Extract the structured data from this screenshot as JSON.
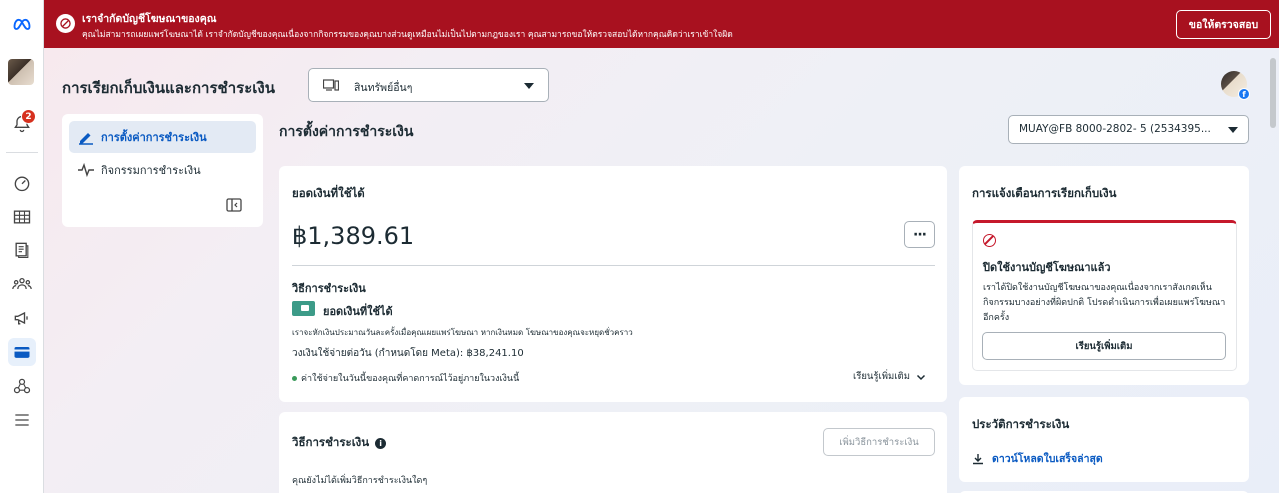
{
  "banner": {
    "title": "เราจำกัดบัญชีโฆษณาของคุณ",
    "subtitle": "คุณไม่สามารถเผยแพร่โฆษณาได้ เราจำกัดบัญชีของคุณเนื่องจากกิจกรรมของคุณบางส่วนดูเหมือนไม่เป็นไปตามกฎของเรา คุณสามารถขอให้ตรวจสอบได้หากคุณคิดว่าเราเข้าใจผิด",
    "review_button": "ขอให้ตรวจสอบ",
    "color": "#a8111f"
  },
  "rail": {
    "notification_count": "2",
    "icons": [
      "meta-logo",
      "profile-avatar",
      "bell-icon",
      "dashboard-icon",
      "table-icon",
      "pages-icon",
      "audience-icon",
      "megaphone-icon",
      "billing-card-icon",
      "business-settings-icon",
      "menu-icon"
    ]
  },
  "header": {
    "page_title": "การเรียกเก็บเงินและการชำระเงิน",
    "asset_select": "สินทรัพย์อื่นๆ"
  },
  "subnav": {
    "items": [
      {
        "label": "การตั้งค่าการชำระเงิน",
        "icon": "pencil-icon",
        "active": true
      },
      {
        "label": "กิจกรรมการชำระเงิน",
        "icon": "activity-icon",
        "active": false
      }
    ]
  },
  "section": {
    "title": "การตั้งค่าการชำระเงิน",
    "account_select": "MUAY@FB 8000-2802- 5 (2534395..."
  },
  "balance": {
    "title": "ยอดเงินที่ใช้ได้",
    "amount": "฿1,389.61",
    "more": "···",
    "method_title": "วิธีการชำระเงิน",
    "method_name": "ยอดเงินที่ใช้ได้",
    "method_desc": "เราจะหักเงินประมาณวันละครั้งเมื่อคุณเผยแพร่โฆษณา หากเงินหมด โฆษณาของคุณจะหยุดชั่วคราว",
    "daily_limit": "วงเงินใช้จ่ายต่อวัน (กำหนดโดย Meta): ฿38,241.10",
    "estimate": "ค่าใช้จ่ายในวันนี้ของคุณที่คาดการณ์ไว้อยู่ภายในวงเงินนี้",
    "learn_more": "เรียนรู้เพิ่มเติม"
  },
  "payment": {
    "title": "วิธีการชำระเงิน",
    "add_button": "เพิ่มวิธีการชำระเงิน",
    "none_text": "คุณยังไม่ได้เพิ่มวิธีการชำระเงินใดๆ"
  },
  "alerts": {
    "title": "การแจ้งเตือนการเรียกเก็บเงิน",
    "alert_title": "ปิดใช้งานบัญชีโฆษณาแล้ว",
    "alert_body": "เราได้ปิดใช้งานบัญชีโฆษณาของคุณเนื่องจากเราสังเกตเห็นกิจกรรมบางอย่างที่ผิดปกติ โปรดดำเนินการเพื่อเผยแพร่โฆษณาอีกครั้ง",
    "learn_button": "เรียนรู้เพิ่มเติม"
  },
  "history": {
    "title": "ประวัติการชำระเงิน",
    "download": "ดาวน์โหลดใบเสร็จล่าสุด"
  }
}
